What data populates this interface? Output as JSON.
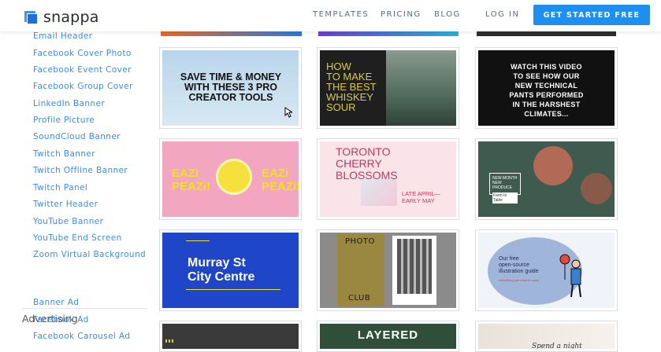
{
  "header": {
    "logo_text": "snappa",
    "nav": [
      "TEMPLATES",
      "PRICING",
      "BLOG"
    ],
    "login": "LOG IN",
    "cta": "GET STARTED FREE"
  },
  "sidebar": {
    "items": [
      "Email Header",
      "Facebook Cover Photo",
      "Facebook Event Cover",
      "Facebook Group Cover",
      "LinkedIn Banner",
      "Profile Picture",
      "SoundCloud Banner",
      "Twitch Banner",
      "Twitch Offline Banner",
      "Twitch Panel",
      "Twitter Header",
      "YouTube Banner",
      "YouTube End Screen",
      "Zoom Virtual Background"
    ],
    "section_heading": "Advertising",
    "ad_items": [
      "Banner Ad",
      "Facebook Ad",
      "Facebook Carousel Ad"
    ]
  },
  "templates": {
    "t1": {
      "text": "SAVE TIME & MONEY WITH THESE 3 PRO CREATOR TOOLS"
    },
    "t2": {
      "lines": [
        "HOW",
        "TO MAKE",
        "THE BEST",
        "WHISKEY",
        "SOUR"
      ]
    },
    "t3": {
      "lines": [
        "WATCH THIS VIDEO",
        "TO SEE HOW OUR",
        "NEW TECHNICAL",
        "PANTS PERFORMED",
        "IN THE HARSHEST",
        "CLIMATES..."
      ]
    },
    "t4": {
      "left": "EAZi PEAZi!",
      "right": "EAZi PEAZi!"
    },
    "t5": {
      "lines": [
        "TORONTO",
        "CHERRY",
        "BLOSSOMS"
      ],
      "date": "LATE APRIL— EARLY MAY"
    },
    "t6": {
      "badge": "NEW MONTH NEW PRODUCE",
      "sub": "Farm to Table"
    },
    "t7": {
      "line1": "Murray St",
      "line2": "City Centre"
    },
    "t8": {
      "top": "PHOTO",
      "bottom": "CLUB"
    },
    "t9": {
      "lines": [
        "Our free",
        "open-source",
        "illustration guide"
      ],
      "small": "everything you need to know"
    },
    "t10": {
      "text": ""
    },
    "t11": {
      "text": "LAYERED"
    },
    "t12": {
      "text": "Spend a night"
    }
  }
}
